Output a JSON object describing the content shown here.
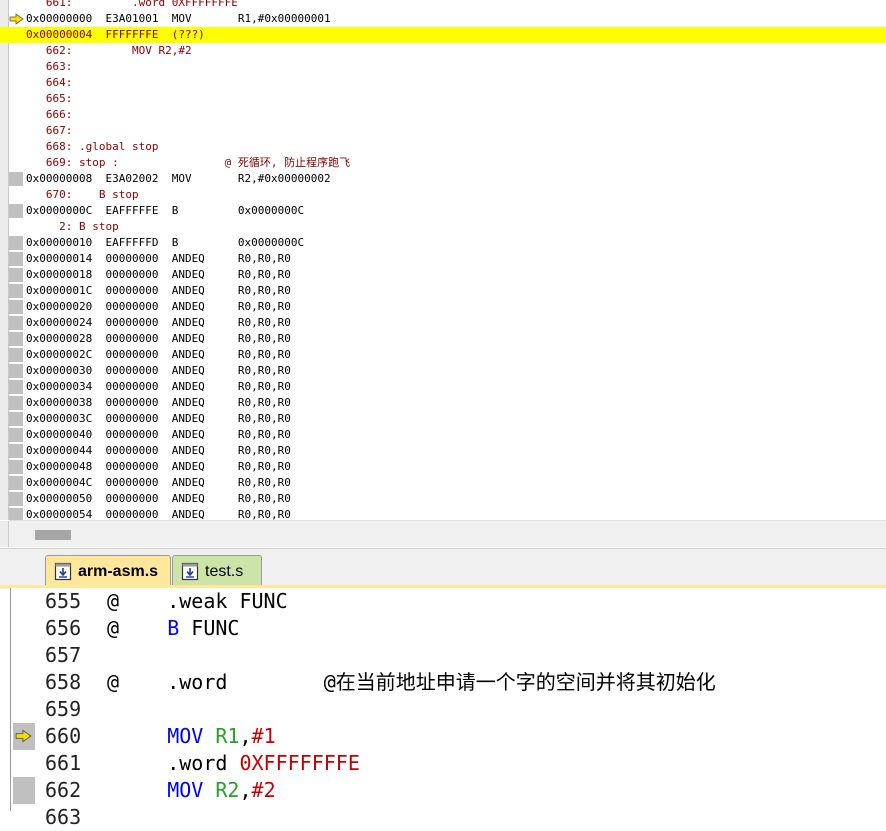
{
  "disassembly": {
    "lines": [
      {
        "kind": "src",
        "text": "   661:         .word 0XFFFFFFFE",
        "marker": "none"
      },
      {
        "kind": "asm",
        "text": "0x00000000  E3A01001  MOV       R1,#0x00000001",
        "marker": "arrow"
      },
      {
        "kind": "cur",
        "text": "0x00000004  FFFFFFFE  (???)",
        "marker": "none"
      },
      {
        "kind": "src",
        "text": "   662:         MOV R2,#2",
        "marker": "none"
      },
      {
        "kind": "src",
        "text": "   663:",
        "marker": "none"
      },
      {
        "kind": "src",
        "text": "   664:",
        "marker": "none"
      },
      {
        "kind": "src",
        "text": "   665:",
        "marker": "none"
      },
      {
        "kind": "src",
        "text": "   666:",
        "marker": "none"
      },
      {
        "kind": "src",
        "text": "   667:",
        "marker": "none"
      },
      {
        "kind": "src",
        "text": "   668: .global stop",
        "marker": "none"
      },
      {
        "kind": "src",
        "text": "   669: stop :                @ 死循环, 防止程序跑飞",
        "marker": "none"
      },
      {
        "kind": "asm",
        "text": "0x00000008  E3A02002  MOV       R2,#0x00000002",
        "marker": "block"
      },
      {
        "kind": "src",
        "text": "   670:    B stop",
        "marker": "none"
      },
      {
        "kind": "asm",
        "text": "0x0000000C  EAFFFFFE  B         0x0000000C",
        "marker": "block"
      },
      {
        "kind": "src",
        "text": "     2: B stop",
        "marker": "none"
      },
      {
        "kind": "asm",
        "text": "0x00000010  EAFFFFFD  B         0x0000000C",
        "marker": "block"
      },
      {
        "kind": "asm",
        "text": "0x00000014  00000000  ANDEQ     R0,R0,R0",
        "marker": "block"
      },
      {
        "kind": "asm",
        "text": "0x00000018  00000000  ANDEQ     R0,R0,R0",
        "marker": "block"
      },
      {
        "kind": "asm",
        "text": "0x0000001C  00000000  ANDEQ     R0,R0,R0",
        "marker": "block"
      },
      {
        "kind": "asm",
        "text": "0x00000020  00000000  ANDEQ     R0,R0,R0",
        "marker": "block"
      },
      {
        "kind": "asm",
        "text": "0x00000024  00000000  ANDEQ     R0,R0,R0",
        "marker": "block"
      },
      {
        "kind": "asm",
        "text": "0x00000028  00000000  ANDEQ     R0,R0,R0",
        "marker": "block"
      },
      {
        "kind": "asm",
        "text": "0x0000002C  00000000  ANDEQ     R0,R0,R0",
        "marker": "block"
      },
      {
        "kind": "asm",
        "text": "0x00000030  00000000  ANDEQ     R0,R0,R0",
        "marker": "block"
      },
      {
        "kind": "asm",
        "text": "0x00000034  00000000  ANDEQ     R0,R0,R0",
        "marker": "block"
      },
      {
        "kind": "asm",
        "text": "0x00000038  00000000  ANDEQ     R0,R0,R0",
        "marker": "block"
      },
      {
        "kind": "asm",
        "text": "0x0000003C  00000000  ANDEQ     R0,R0,R0",
        "marker": "block"
      },
      {
        "kind": "asm",
        "text": "0x00000040  00000000  ANDEQ     R0,R0,R0",
        "marker": "block"
      },
      {
        "kind": "asm",
        "text": "0x00000044  00000000  ANDEQ     R0,R0,R0",
        "marker": "block"
      },
      {
        "kind": "asm",
        "text": "0x00000048  00000000  ANDEQ     R0,R0,R0",
        "marker": "block"
      },
      {
        "kind": "asm",
        "text": "0x0000004C  00000000  ANDEQ     R0,R0,R0",
        "marker": "block"
      },
      {
        "kind": "asm",
        "text": "0x00000050  00000000  ANDEQ     R0,R0,R0",
        "marker": "block"
      },
      {
        "kind": "asm",
        "text": "0x00000054  00000000  ANDEQ     R0,R0,R0",
        "marker": "block"
      }
    ]
  },
  "tabs": [
    {
      "label": "arm-asm.s",
      "active": true
    },
    {
      "label": "test.s",
      "active": false
    }
  ],
  "editor": {
    "lines": [
      {
        "num": "655",
        "marker": "none",
        "parts": [
          {
            "c": "cmt",
            "t": "@    .weak FUNC"
          }
        ]
      },
      {
        "num": "656",
        "marker": "none",
        "parts": [
          {
            "c": "cmt",
            "t": "@    "
          },
          {
            "c": "kw",
            "t": "B"
          },
          {
            "c": "cmt",
            "t": " FUNC"
          }
        ]
      },
      {
        "num": "657",
        "marker": "none",
        "parts": []
      },
      {
        "num": "658",
        "marker": "none",
        "parts": [
          {
            "c": "cmt",
            "t": "@    .word        @在当前地址申请一个字的空间并将其初始化"
          }
        ]
      },
      {
        "num": "659",
        "marker": "none",
        "parts": []
      },
      {
        "num": "660",
        "marker": "arrow",
        "parts": [
          {
            "c": "cmt",
            "t": "     "
          },
          {
            "c": "kw",
            "t": "MOV"
          },
          {
            "c": "cmt",
            "t": " "
          },
          {
            "c": "reg",
            "t": "R1"
          },
          {
            "c": "cmt",
            "t": ","
          },
          {
            "c": "num",
            "t": "#1"
          }
        ]
      },
      {
        "num": "661",
        "marker": "none",
        "parts": [
          {
            "c": "cmt",
            "t": "     .word "
          },
          {
            "c": "num",
            "t": "0XFFFFFFFE"
          }
        ]
      },
      {
        "num": "662",
        "marker": "block",
        "parts": [
          {
            "c": "cmt",
            "t": "     "
          },
          {
            "c": "kw",
            "t": "MOV"
          },
          {
            "c": "cmt",
            "t": " "
          },
          {
            "c": "reg",
            "t": "R2"
          },
          {
            "c": "cmt",
            "t": ","
          },
          {
            "c": "num",
            "t": "#2"
          }
        ]
      },
      {
        "num": "663",
        "marker": "none",
        "parts": []
      }
    ]
  },
  "colors": {
    "current_line": "#ffff00",
    "arrow": "#ffdd00",
    "keyword": "#0000ff",
    "register": "#2aa02a",
    "number": "#c80000",
    "source_text": "#8b0000"
  }
}
